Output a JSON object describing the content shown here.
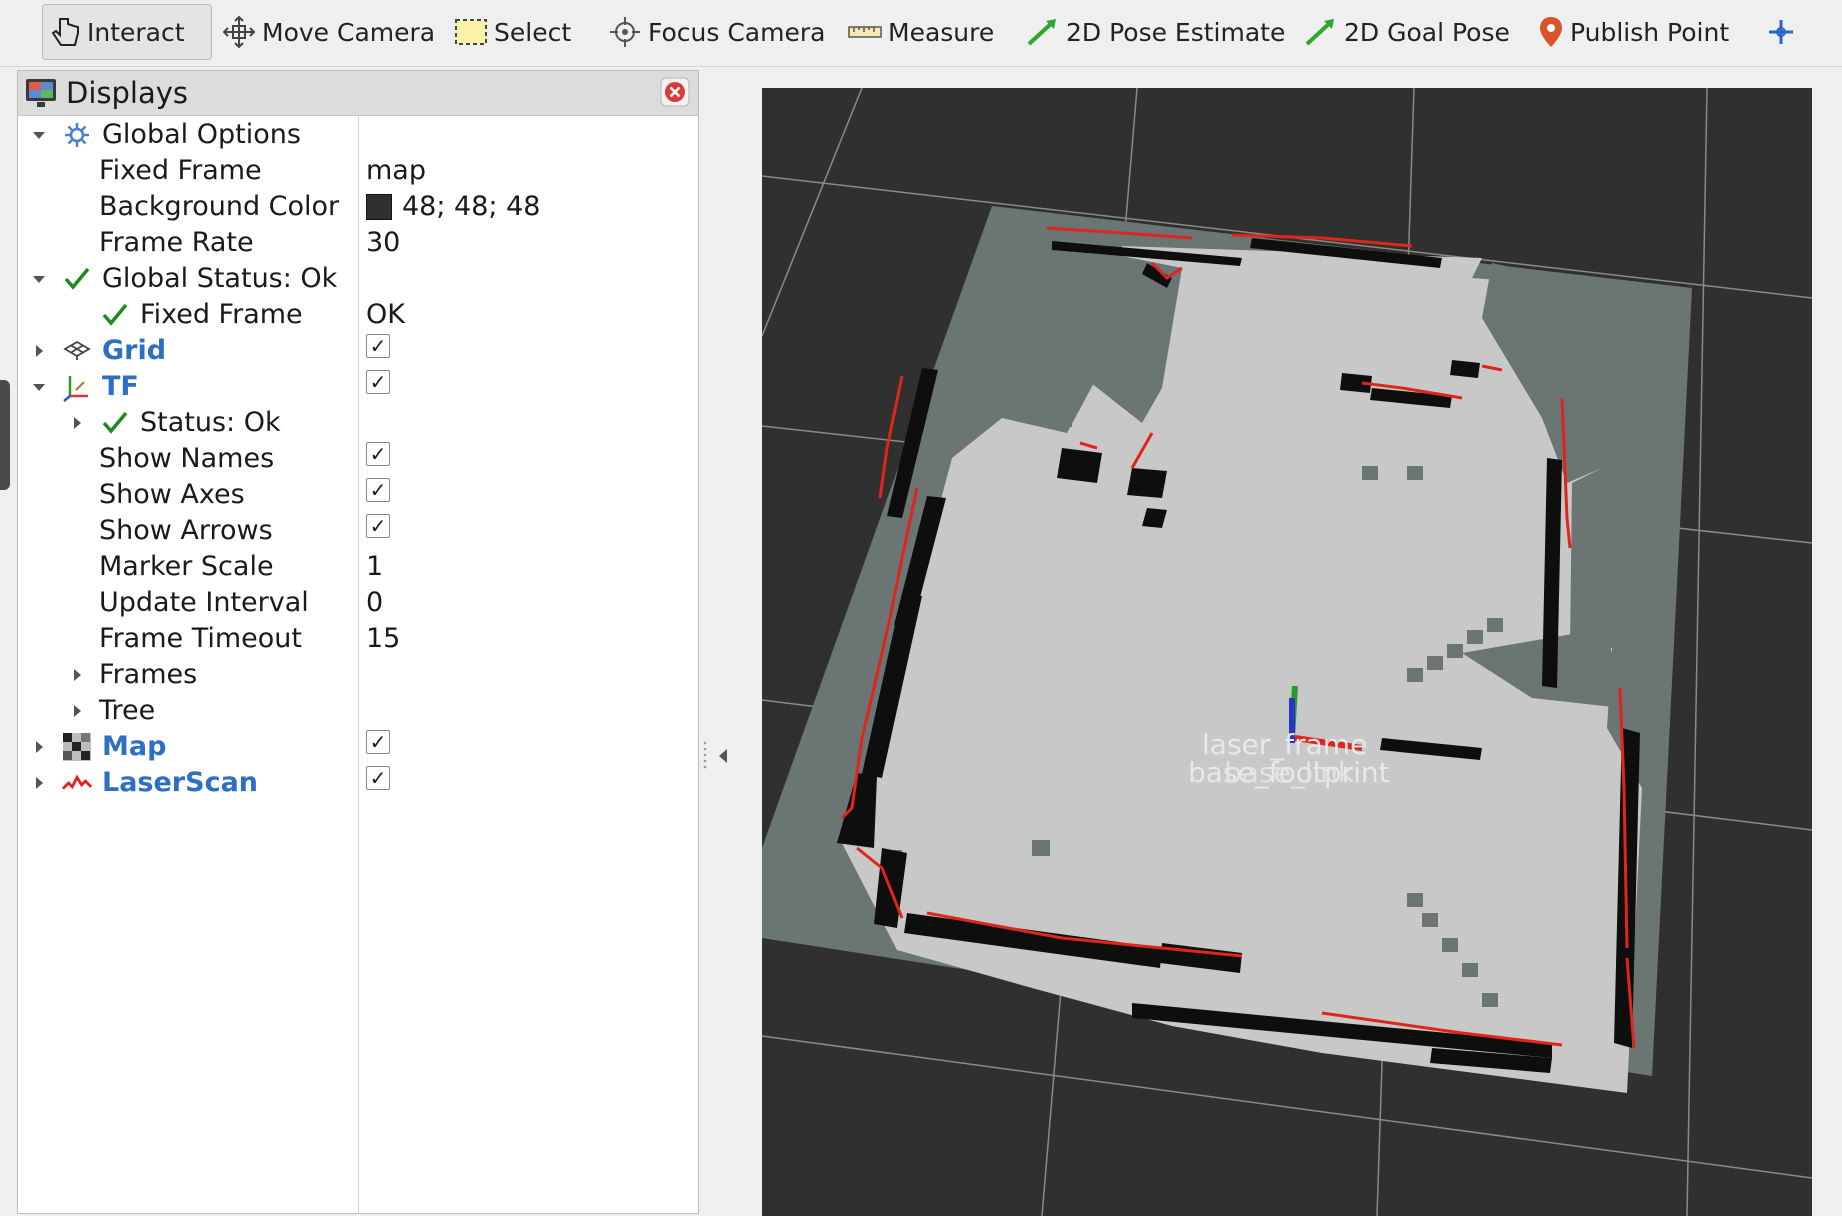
{
  "toolbar": {
    "interact": "Interact",
    "move_camera": "Move Camera",
    "select": "Select",
    "focus_camera": "Focus Camera",
    "measure": "Measure",
    "pose_estimate": "2D Pose Estimate",
    "goal_pose": "2D Goal Pose",
    "publish_point": "Publish Point",
    "active_tool": "Interact"
  },
  "displays_panel": {
    "title": "Displays",
    "global_options": {
      "label": "Global Options",
      "fixed_frame_label": "Fixed Frame",
      "fixed_frame_value": "map",
      "background_color_label": "Background Color",
      "background_color_value": "48; 48; 48",
      "background_color_hex": "#303030",
      "frame_rate_label": "Frame Rate",
      "frame_rate_value": "30"
    },
    "global_status": {
      "label": "Global Status: Ok",
      "fixed_frame_label": "Fixed Frame",
      "fixed_frame_value": "OK"
    },
    "grid": {
      "label": "Grid",
      "enabled": true
    },
    "tf": {
      "label": "TF",
      "enabled": true,
      "status_label": "Status: Ok",
      "show_names_label": "Show Names",
      "show_names": true,
      "show_axes_label": "Show Axes",
      "show_axes": true,
      "show_arrows_label": "Show Arrows",
      "show_arrows": true,
      "marker_scale_label": "Marker Scale",
      "marker_scale_value": "1",
      "update_interval_label": "Update Interval",
      "update_interval_value": "0",
      "frame_timeout_label": "Frame Timeout",
      "frame_timeout_value": "15",
      "frames_label": "Frames",
      "tree_label": "Tree"
    },
    "map": {
      "label": "Map",
      "enabled": true
    },
    "laserscan": {
      "label": "LaserScan",
      "enabled": true
    },
    "check_glyph": "✓"
  },
  "viewport": {
    "background": "#303030",
    "frame_labels": {
      "laser_frame": "laser_frame",
      "base_stack": "base_footprint",
      "base_link": "base_link"
    }
  },
  "colors": {
    "accent_blue": "#2d6fc4",
    "ok_green": "#1f8a1f",
    "laser_red": "#e0251c",
    "map_free": "#c8c8c8",
    "map_unknown": "#6b7574",
    "map_occupied": "#0e0e0e"
  }
}
